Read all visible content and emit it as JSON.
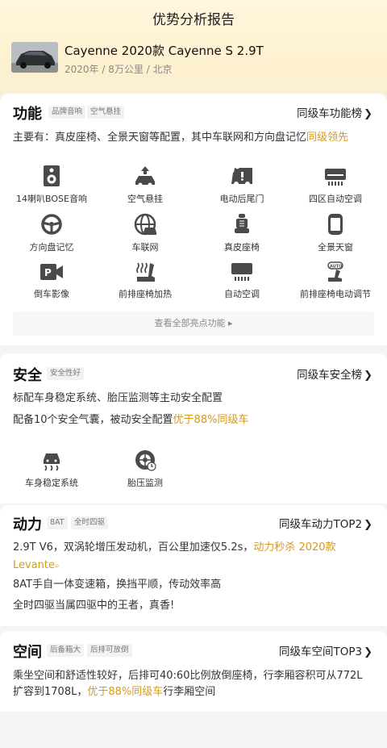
{
  "header": {
    "title": "优势分析报告",
    "car_name": "Cayenne 2020款 Cayenne S 2.9T",
    "car_meta": "2020年 / 8万公里 / 北京"
  },
  "colors": {
    "highlight": "#d49a1a",
    "icon": "#555555",
    "card_bg": "#ffffff"
  },
  "features": {
    "title": "功能",
    "tags": [
      "品牌音响",
      "空气悬挂"
    ],
    "rank": "同级车功能榜",
    "desc_main": "主要有：真皮座椅、全景天窗等配置，其中车联网和方向盘记忆",
    "desc_hl": "同级领先",
    "items": [
      {
        "label": "14喇叭BOSE音响",
        "icon": "speaker-icon"
      },
      {
        "label": "空气悬挂",
        "icon": "air-suspension-icon"
      },
      {
        "label": "电动后尾门",
        "icon": "power-tailgate-icon"
      },
      {
        "label": "四区自动空调",
        "icon": "climate-zone-icon"
      },
      {
        "label": "方向盘记忆",
        "icon": "steering-wheel-icon"
      },
      {
        "label": "车联网",
        "icon": "connected-car-icon"
      },
      {
        "label": "真皮座椅",
        "icon": "leather-seat-icon"
      },
      {
        "label": "全景天窗",
        "icon": "panoramic-roof-icon"
      },
      {
        "label": "倒车影像",
        "icon": "reverse-camera-icon"
      },
      {
        "label": "前排座椅加热",
        "icon": "seat-heating-icon"
      },
      {
        "label": "自动空调",
        "icon": "auto-ac-icon"
      },
      {
        "label": "前排座椅电动调节",
        "icon": "power-seat-icon"
      }
    ],
    "more": "查看全部亮点功能"
  },
  "safety": {
    "title": "安全",
    "tag": "安全性好",
    "rank": "同级车安全榜",
    "line1": "标配车身稳定系统、胎压监测等主动安全配置",
    "line2_main": "配备10个安全气囊，被动安全配置",
    "line2_hl": "优于88%同级车",
    "items": [
      {
        "label": "车身稳定系统",
        "icon": "stability-control-icon"
      },
      {
        "label": "胎压监测",
        "icon": "tire-pressure-icon"
      }
    ]
  },
  "power": {
    "title": "动力",
    "tags": [
      "8AT",
      "全时四驱"
    ],
    "rank": "同级车动力TOP2",
    "line1_main": "2.9T V6，双涡轮增压发动机，百公里加速仅5.2s，",
    "line1_hl": "动力秒杀 2020款",
    "line1_hl2": "Levante",
    "line2": "8AT手自一体变速箱，换挡平顺，传动效率高",
    "line3": "全时四驱当属四驱中的王者，真香!"
  },
  "space": {
    "title": "空间",
    "tags": [
      "后备箱大",
      "后排可放倒"
    ],
    "rank": "同级车空间TOP3",
    "line1": "乘坐空间和舒适性较好，后排可40:60比例放倒座椅，行李厢容积可从772L",
    "line2_pre": "扩容到1708L，",
    "line2_hl": "优于88%同级车",
    "line2_post": "行李厢空间"
  }
}
